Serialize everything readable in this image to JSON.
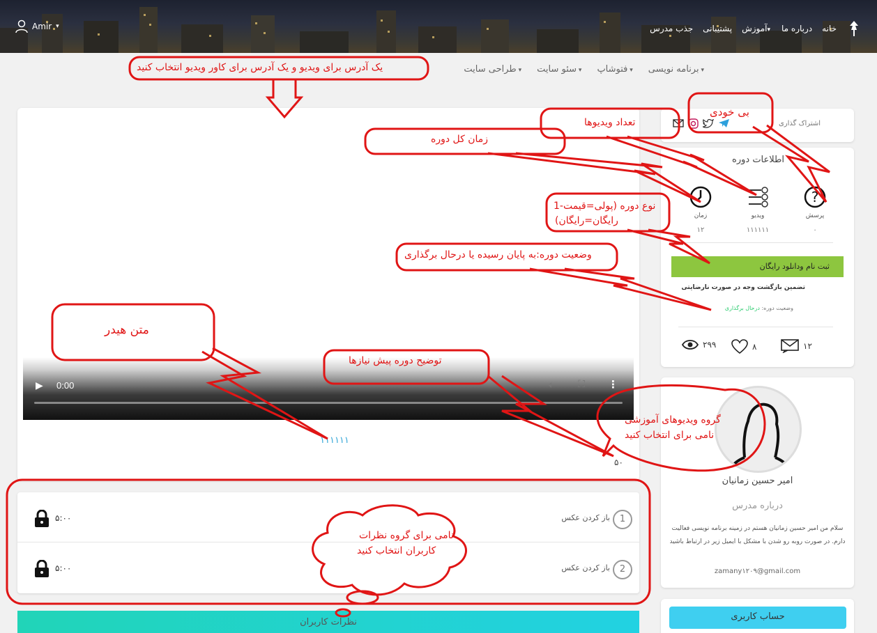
{
  "header": {
    "user": "Amir",
    "nav": [
      "خانه",
      "درباره ما",
      "آموزش",
      "پشتیبانی",
      "جذب مدرس"
    ],
    "colors": {
      "dark": "#1d2230"
    }
  },
  "subnav": [
    "برنامه نویسی",
    "فتوشاپ",
    "سئو سایت",
    "طراحی سایت"
  ],
  "video": {
    "time": "0:00",
    "play_icon": "play-icon"
  },
  "prereq_text": "۱۱۱۱۱۱",
  "fifty": "۵۰",
  "lessons": [
    {
      "num": "1",
      "title": "باز کردن عکس",
      "duration": "۵:۰۰"
    },
    {
      "num": "2",
      "title": "باز کردن عکس",
      "duration": "۵:۰۰"
    }
  ],
  "comments_label": "نظرات کاربران",
  "share": {
    "label": "اشتراک گذاری"
  },
  "info": {
    "title": "اطلاعات دوره",
    "stats": [
      {
        "label": "پرسش",
        "value": "۰"
      },
      {
        "label": "ویدیو",
        "value": "۱۱۱۱۱۱"
      },
      {
        "label": "زمان",
        "value": "۱۲"
      }
    ],
    "register": "ثبت نام ودانلود",
    "price": "رایگان",
    "guarantee": "تضمین بازگشت وجه در صورت نارضایتی",
    "status_label": "وضعیت دوره:",
    "status_value": "درحال برگذاری",
    "views": "۲۹۹",
    "likes": "۸",
    "messages": "۱۲"
  },
  "teacher": {
    "name": "امیر حسین زمانیان",
    "about_title": "درباره مدرس",
    "bio": "سلام من امیر حسین زمانیان هستم در زمینه برنامه نویسی فعالیت دارم. در صورت روبه رو شدن با مشکل با ایمیل زیر در ارتباط باشید",
    "email": "zamany۱۲۰۹@gmail.com"
  },
  "account_label": "حساب کاربری",
  "annotations": {
    "video_address": "یک آدرس برای ویدیو و یک آدرس برای کاور ویدیو انتخاب کنید",
    "bi_khodi": "بی خودی",
    "video_count": "تعداد ویدیوها",
    "total_time": "زمان کل دوره",
    "course_type_1": "1-نوع دوره (پولی=قیمت",
    "course_type_2": "رایگان=رایگان)",
    "course_status": "وضعیت دوره:به پایان رسیده یا درحال برگذاری",
    "header_text": "متن هیدر",
    "prereq_desc": "توضیح دوره پیش نیازها",
    "group_1": "گروه ویدیوهای آموزشی",
    "group_2": "نامی برای انتخاب کنید",
    "comments_1": "نامی برای گروه نظرات",
    "comments_2": "کاربران انتخاب کنید"
  }
}
